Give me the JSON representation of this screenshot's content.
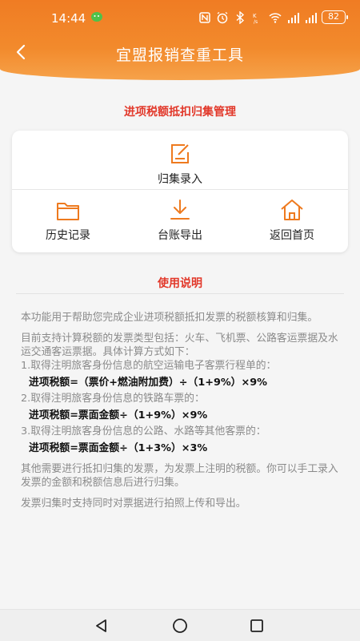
{
  "status": {
    "time": "14:44",
    "battery": "82"
  },
  "nav": {
    "title": "宜盟报销查重工具"
  },
  "section_title": "进项税额抵扣归集管理",
  "actions": {
    "collect": "归集录入",
    "history": "历史记录",
    "export": "台账导出",
    "home": "返回首页"
  },
  "help": {
    "title": "使用说明",
    "p1": "本功能用于帮助您完成企业进项税额抵扣发票的税额核算和归集。",
    "p2": "目前支持计算税额的发票类型包括：火车、飞机票、公路客运票据及水运交通客运票据。具体计算方式如下：",
    "item1": "1.取得注明旅客身份信息的航空运输电子客票行程单的：",
    "formula1": "进项税额=（票价+燃油附加费）÷（1+9%）×9%",
    "item2": "2.取得注明旅客身份信息的铁路车票的：",
    "formula2": "进项税额=票面金额÷（1+9%）×9%",
    "item3": "3.取得注明旅客身份信息的公路、水路等其他客票的：",
    "formula3": "进项税额=票面金额÷（1+3%）×3%",
    "p3": "其他需要进行抵扣归集的发票，为发票上注明的税额。你可以手工录入发票的金额和税额信息后进行归集。",
    "p4": "发票归集时支持同时对票据进行拍照上传和导出。"
  },
  "colors": {
    "brand": "#f07c23",
    "accent_red": "#e2382a",
    "icon_orange": "#ee7a1f"
  }
}
